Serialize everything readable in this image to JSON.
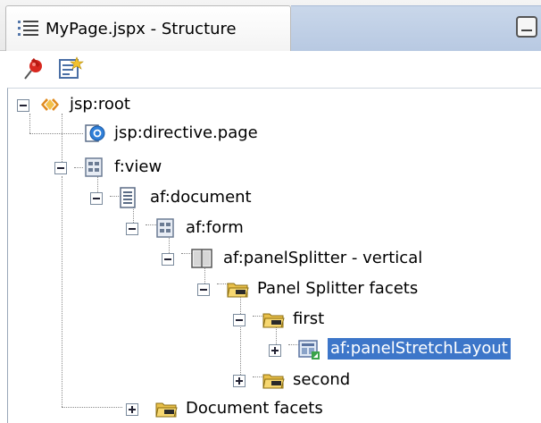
{
  "panel": {
    "title": "MyPage.jspx - Structure"
  },
  "toolbar": {
    "buttons": [
      {
        "icon": "pin-icon"
      },
      {
        "icon": "new-property-icon"
      }
    ]
  },
  "tree": {
    "nodes": [
      {
        "label": "jsp:root",
        "icon": "jsp-root-icon",
        "expanded": true
      },
      {
        "label": "jsp:directive.page",
        "icon": "directive-icon"
      },
      {
        "label": "f:view",
        "icon": "view-icon",
        "expanded": true
      },
      {
        "label": "af:document",
        "icon": "document-icon",
        "expanded": true
      },
      {
        "label": "af:form",
        "icon": "form-icon",
        "expanded": true
      },
      {
        "label": "af:panelSplitter - vertical",
        "icon": "panel-splitter-icon",
        "expanded": true
      },
      {
        "label": "Panel Splitter facets",
        "icon": "folder-icon",
        "expanded": true
      },
      {
        "label": "first",
        "icon": "folder-icon",
        "expanded": true
      },
      {
        "label": "af:panelStretchLayout",
        "icon": "panel-stretch-layout-icon",
        "expanded": false,
        "selected": true
      },
      {
        "label": "second",
        "icon": "folder-icon",
        "expanded": false
      },
      {
        "label": "Document facets",
        "icon": "folder-icon",
        "expanded": false
      }
    ]
  },
  "colors": {
    "selection": "#3d76c9",
    "tab_background": "#c9d7ea"
  }
}
